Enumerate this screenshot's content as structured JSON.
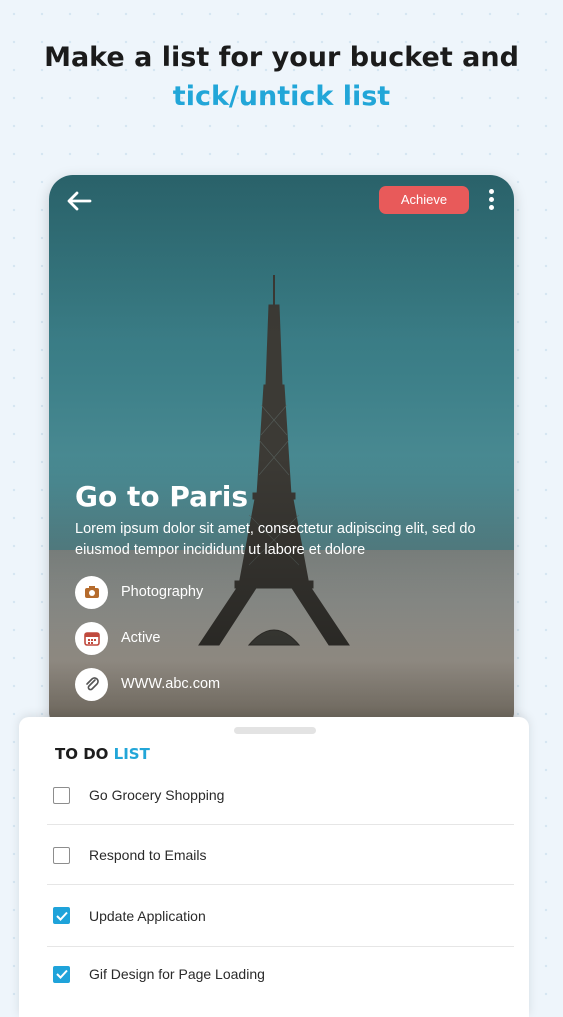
{
  "header": {
    "line1": "Make a list for your bucket and",
    "line2": "tick/untick list"
  },
  "card": {
    "achieve_label": "Achieve",
    "title": "Go to Paris",
    "description": "Lorem ipsum dolor sit amet, consectetur adipiscing elit, sed do eiusmod tempor incididunt ut labore et dolore",
    "meta": [
      {
        "icon": "camera-icon",
        "label": "Photography"
      },
      {
        "icon": "calendar-icon",
        "label": "Active"
      },
      {
        "icon": "paperclip-icon",
        "label": "WWW.abc.com"
      }
    ]
  },
  "todo": {
    "title_part1": "TO DO",
    "title_part2": "LIST",
    "items": [
      {
        "label": "Go Grocery Shopping",
        "checked": false
      },
      {
        "label": "Respond to Emails",
        "checked": false
      },
      {
        "label": "Update Application",
        "checked": true
      },
      {
        "label": "Gif Design for Page Loading",
        "checked": true
      }
    ]
  },
  "colors": {
    "accent": "#22a6d8",
    "achieve_button": "#e85a5a",
    "checkbox_checked": "#1fa3da"
  }
}
